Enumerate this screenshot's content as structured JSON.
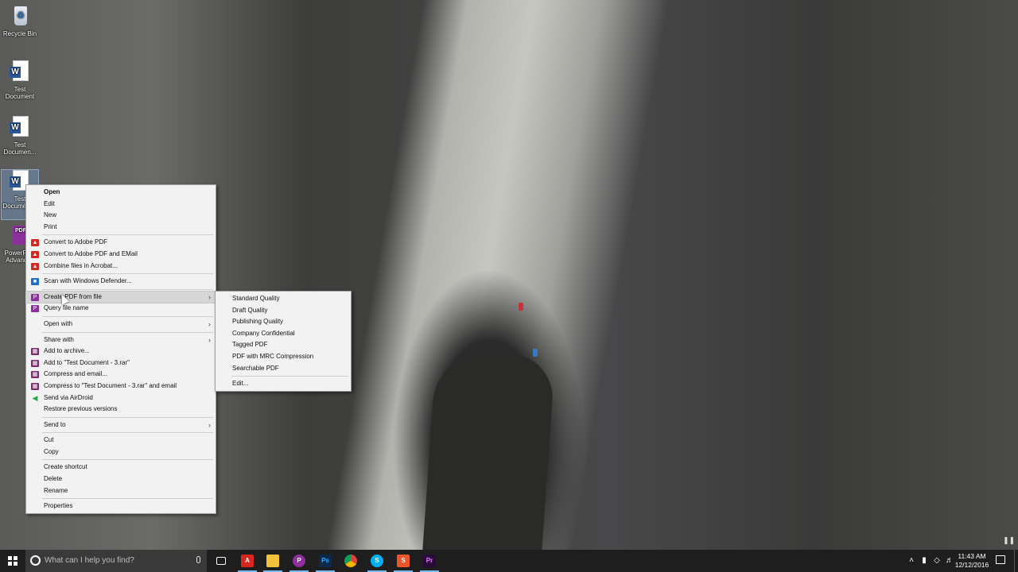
{
  "desktop": {
    "icons": [
      {
        "label": "Recycle Bin",
        "icon": "recycle-bin-icon"
      },
      {
        "label": "Test Document",
        "icon": "word-document-icon"
      },
      {
        "label": "Test Documen...",
        "icon": "word-document-icon"
      },
      {
        "label": "Test Docume... 3",
        "icon": "word-document-icon"
      },
      {
        "label": "PowerPDF Advanced",
        "icon": "pdf-app-icon"
      }
    ]
  },
  "context_menu": {
    "items": [
      {
        "label": "Open"
      },
      {
        "label": "Edit"
      },
      {
        "label": "New"
      },
      {
        "label": "Print"
      },
      {
        "label": "Convert to Adobe PDF"
      },
      {
        "label": "Convert to Adobe PDF and EMail"
      },
      {
        "label": "Combine files in Acrobat..."
      },
      {
        "label": "Scan with Windows Defender..."
      },
      {
        "label": "Create PDF from file"
      },
      {
        "label": "Query file name"
      },
      {
        "label": "Open with"
      },
      {
        "label": "Share with"
      },
      {
        "label": "Add to archive..."
      },
      {
        "label": "Add to \"Test Document - 3.rar\""
      },
      {
        "label": "Compress and email..."
      },
      {
        "label": "Compress to \"Test Document - 3.rar\" and email"
      },
      {
        "label": "Send via AirDroid"
      },
      {
        "label": "Restore previous versions"
      },
      {
        "label": "Send to"
      },
      {
        "label": "Cut"
      },
      {
        "label": "Copy"
      },
      {
        "label": "Create shortcut"
      },
      {
        "label": "Delete"
      },
      {
        "label": "Rename"
      },
      {
        "label": "Properties"
      }
    ]
  },
  "submenu": {
    "items": [
      {
        "label": "Standard Quality"
      },
      {
        "label": "Draft Quality"
      },
      {
        "label": "Publishing Quality"
      },
      {
        "label": "Company Confidential"
      },
      {
        "label": "Tagged PDF"
      },
      {
        "label": "PDF with MRC Compression"
      },
      {
        "label": "Searchable PDF"
      },
      {
        "label": "Edit..."
      }
    ]
  },
  "taskbar": {
    "search_placeholder": "What can I help you find?",
    "time": "11:43 AM",
    "date": "12/12/2016",
    "apps": [
      {
        "name": "task-view-icon"
      },
      {
        "name": "acrobat-icon",
        "color": "#d7261e"
      },
      {
        "name": "file-explorer-icon",
        "color": "#f3c13a"
      },
      {
        "name": "powerpdf-icon",
        "color": "#8e2f9e"
      },
      {
        "name": "photoshop-icon",
        "color": "#0b2a4a"
      },
      {
        "name": "chrome-icon",
        "color": "#e5a823"
      },
      {
        "name": "skype-icon",
        "color": "#00aff0"
      },
      {
        "name": "snagit-icon",
        "color": "#e8562a"
      },
      {
        "name": "premiere-icon",
        "color": "#2a0a3b"
      }
    ]
  },
  "colors": {
    "menu_bg": "#f2f2f2",
    "menu_hover": "#d6d6d6",
    "taskbar_bg": "#1e1e1e",
    "accent": "#76b9ed"
  }
}
